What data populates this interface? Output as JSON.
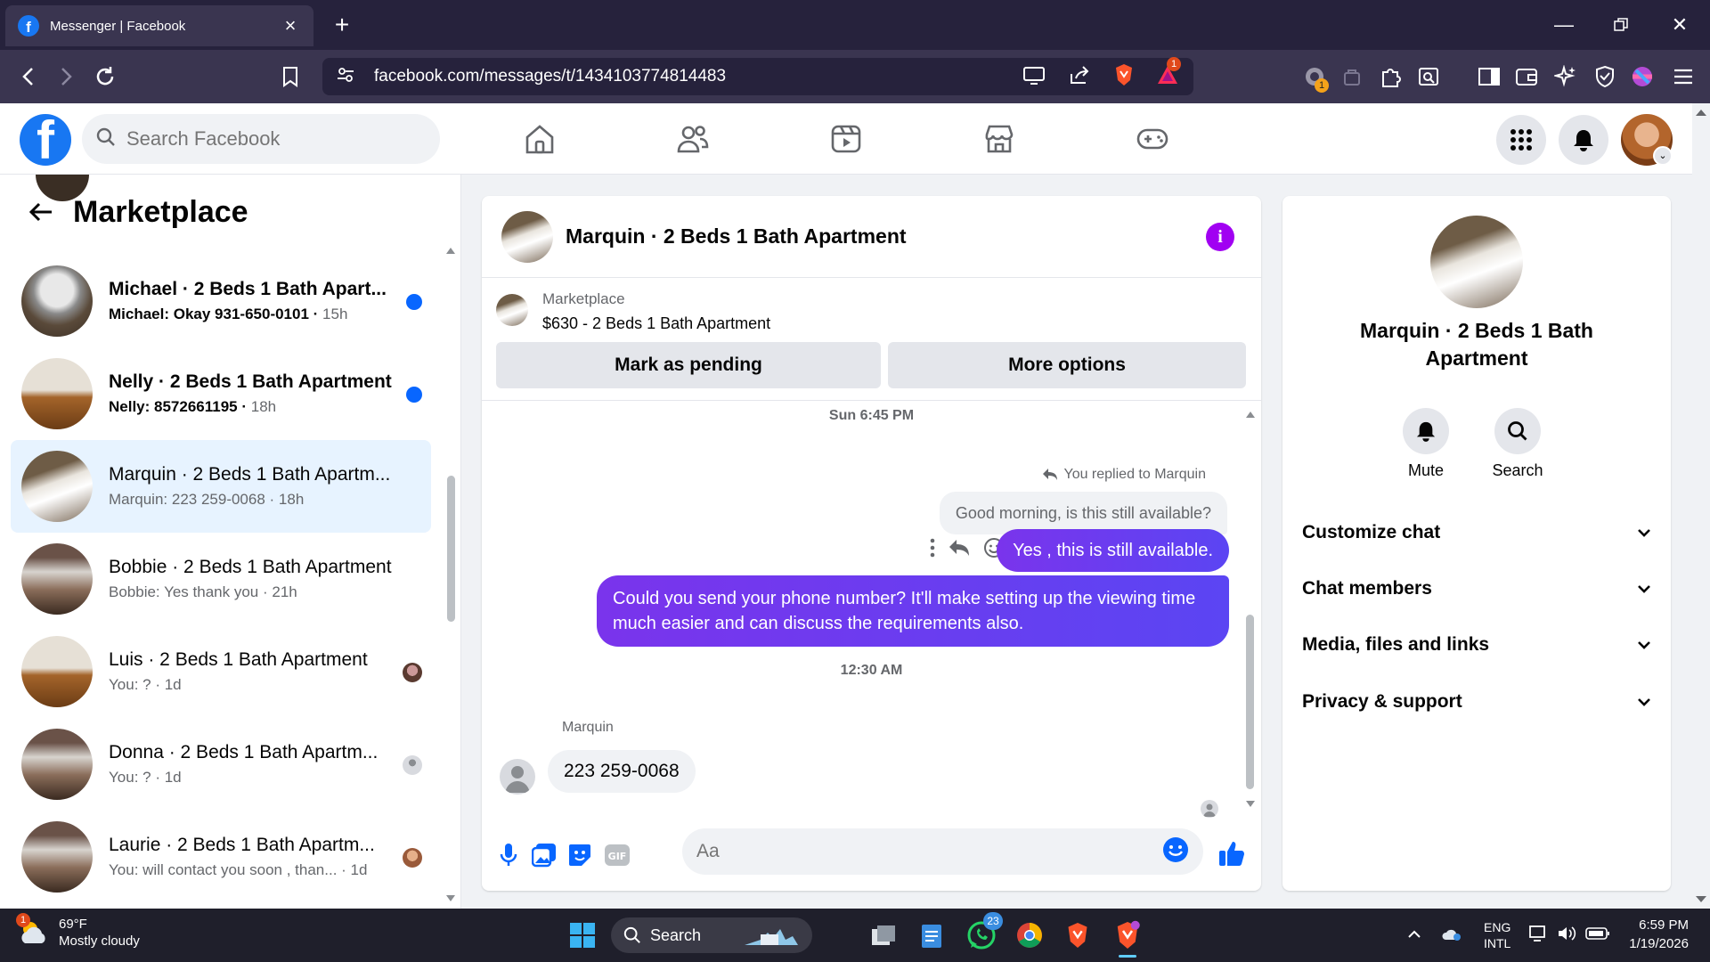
{
  "browser": {
    "tab_title": "Messenger | Facebook",
    "url": "facebook.com/messages/t/1434103774814483",
    "extension_badge": "1",
    "alert_badge": "1"
  },
  "fb": {
    "search_placeholder": "Search Facebook"
  },
  "left": {
    "title": "Marketplace",
    "conversations": [
      {
        "name": "Michael · 2 Beds 1 Bath Apart...",
        "preview": "Michael: Okay 931-650-0101",
        "time": "15h",
        "unread": true
      },
      {
        "name": "Nelly · 2 Beds 1 Bath Apartment",
        "preview": "Nelly: 8572661195",
        "time": "18h",
        "unread": true
      },
      {
        "name": "Marquin · 2 Beds 1 Bath Apartm...",
        "preview": "Marquin: 223 259-0068",
        "time": "18h",
        "active": true
      },
      {
        "name": "Bobbie · 2 Beds 1 Bath Apartment",
        "preview": "Bobbie: Yes thank you",
        "time": "21h"
      },
      {
        "name": "Luis · 2 Beds 1 Bath Apartment",
        "preview": "You: ?",
        "time": "1d"
      },
      {
        "name": "Donna · 2 Beds 1 Bath Apartm...",
        "preview": "You: ?",
        "time": "1d"
      },
      {
        "name": "Laurie · 2 Beds 1 Bath Apartm...",
        "preview": "You: will contact you soon , than...",
        "time": "1d"
      }
    ]
  },
  "chat": {
    "title": "Marquin · 2 Beds 1 Bath Apartment",
    "marketplace_label": "Marketplace",
    "listing": "$630 - 2 Beds 1 Bath Apartment",
    "mark_pending": "Mark as pending",
    "more_options": "More options",
    "timestamp1": "Sun 6:45 PM",
    "replied_note": "You replied to Marquin",
    "quoted_message": "Good morning, is this still available?",
    "msg_reply": "Yes , this is still available.",
    "msg_phone_request": "Could you send your phone number? It'll make setting up the viewing time much easier and can discuss the requirements also.",
    "timestamp2": "12:30 AM",
    "sender_name": "Marquin",
    "msg_in": "223 259-0068",
    "input_placeholder": "Aa"
  },
  "right": {
    "title": "Marquin · 2 Beds 1 Bath Apartment",
    "mute": "Mute",
    "search": "Search",
    "sections": [
      "Customize chat",
      "Chat members",
      "Media, files and links",
      "Privacy & support"
    ]
  },
  "taskbar": {
    "temp": "69°F",
    "weather": "Mostly cloudy",
    "weather_badge": "1",
    "search": "Search",
    "whatsapp_badge": "23",
    "lang1": "ENG",
    "lang2": "INTL",
    "time": "6:59 PM",
    "date": "1/19/2026"
  },
  "colors": {
    "fb_blue": "#1877f2",
    "unread_dot": "#0866ff",
    "active_row": "#e7f3ff",
    "bubble_out": "#6a3cf0",
    "info_purple": "#a100f2"
  }
}
